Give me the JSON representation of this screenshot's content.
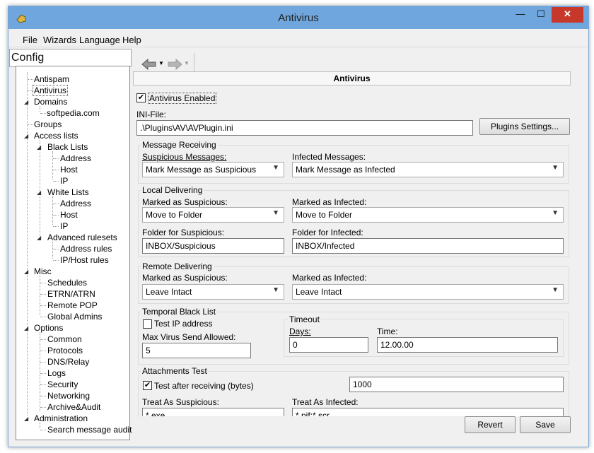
{
  "window": {
    "title": "Antivirus",
    "minimize": "—",
    "maximize": "☐",
    "close": "✕"
  },
  "menu": [
    "File",
    "Wizards",
    "Language",
    "Help"
  ],
  "left_panel": {
    "title": "Config"
  },
  "tree": [
    {
      "label": "Antispam"
    },
    {
      "label": "Antivirus"
    },
    {
      "label": "Domains"
    },
    {
      "label": "softpedia.com"
    },
    {
      "label": "Groups"
    },
    {
      "label": "Access lists"
    },
    {
      "label": "Black Lists"
    },
    {
      "label": "Address"
    },
    {
      "label": "Host"
    },
    {
      "label": "IP"
    },
    {
      "label": "White Lists"
    },
    {
      "label": "Address"
    },
    {
      "label": "Host"
    },
    {
      "label": "IP"
    },
    {
      "label": "Advanced rulesets"
    },
    {
      "label": "Address rules"
    },
    {
      "label": "IP/Host rules"
    },
    {
      "label": "Misc"
    },
    {
      "label": "Schedules"
    },
    {
      "label": "ETRN/ATRN"
    },
    {
      "label": "Remote POP"
    },
    {
      "label": "Global Admins"
    },
    {
      "label": "Options"
    },
    {
      "label": "Common"
    },
    {
      "label": "Protocols"
    },
    {
      "label": "DNS/Relay"
    },
    {
      "label": "Logs"
    },
    {
      "label": "Security"
    },
    {
      "label": "Networking"
    },
    {
      "label": "Archive&Audit"
    },
    {
      "label": "Administration"
    },
    {
      "label": "Search message audit"
    }
  ],
  "panel": {
    "title": "Antivirus",
    "enabled_label": "Antivirus Enabled",
    "ini_label": "INI-File:",
    "ini_value": ".\\Plugins\\AV\\AVPlugin.ini",
    "plugins_button": "Plugins Settings...",
    "message_receiving": {
      "title": "Message Receiving",
      "suspicious_label": "Suspicious Messages:",
      "suspicious_value": "Mark Message as Suspicious",
      "infected_label": "Infected Messages:",
      "infected_value": "Mark Message as Infected"
    },
    "local_delivering": {
      "title": "Local Delivering",
      "marked_suspicious_label": "Marked as Suspicious:",
      "marked_suspicious_value": "Move to Folder",
      "marked_infected_label": "Marked as Infected:",
      "marked_infected_value": "Move to Folder",
      "folder_suspicious_label": "Folder for Suspicious:",
      "folder_suspicious_value": "INBOX/Suspicious",
      "folder_infected_label": "Folder for Infected:",
      "folder_infected_value": "INBOX/Infected"
    },
    "remote_delivering": {
      "title": "Remote Delivering",
      "marked_suspicious_label": "Marked as Suspicious:",
      "marked_suspicious_value": "Leave Intact",
      "marked_infected_label": "Marked as Infected:",
      "marked_infected_value": "Leave Intact"
    },
    "temporal_black_list": {
      "title": "Temporal Black List",
      "test_ip_label": "Test IP address",
      "max_virus_label": "Max Virus Send Allowed:",
      "max_virus_value": "5",
      "timeout_title": "Timeout",
      "days_label": "Days:",
      "days_value": "0",
      "time_label": "Time:",
      "time_value": "12.00.00"
    },
    "attachments_test": {
      "title": "Attachments Test",
      "test_after_label": "Test after receiving (bytes)",
      "bytes_value": "1000",
      "treat_suspicious_label": "Treat As Suspicious:",
      "treat_suspicious_value": "*.exe",
      "treat_infected_label": "Treat As Infected:",
      "treat_infected_value": "*.pif;*.scr"
    }
  },
  "buttons": {
    "revert": "Revert",
    "save": "Save"
  }
}
